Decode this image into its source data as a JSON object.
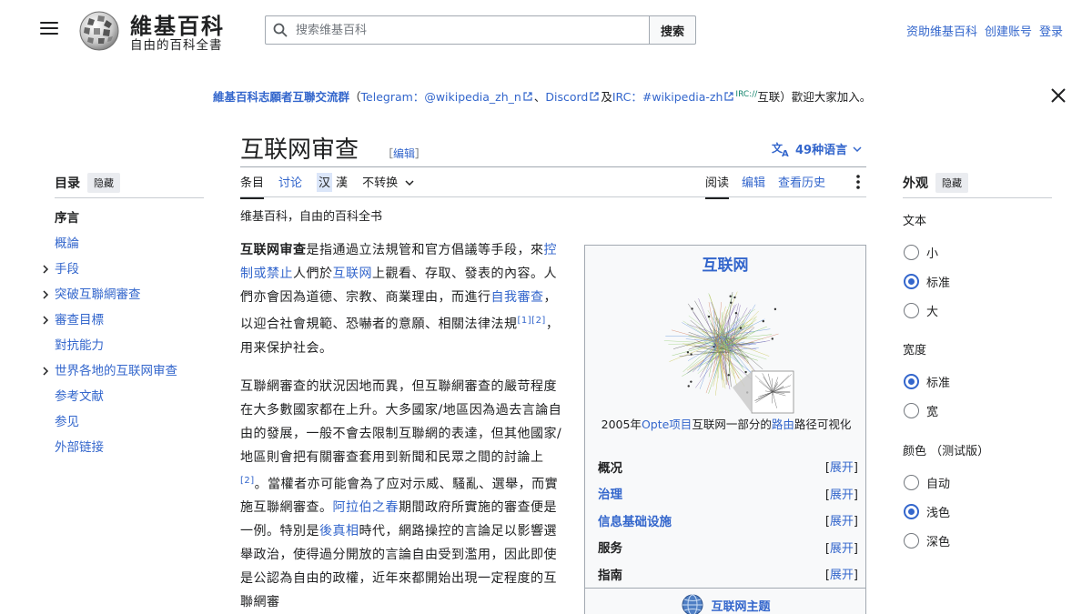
{
  "header": {
    "logo_title": "維基百科",
    "logo_tagline": "自由的百科全書",
    "search_placeholder": "搜索维基百科",
    "search_button": "搜索",
    "user_links": [
      "资助维基百科",
      "创建账号",
      "登录"
    ]
  },
  "sitenotice": {
    "group_name": "維基百科志願者互聯交流群",
    "open_paren": "（",
    "telegram_label": "Telegram：",
    "telegram_handle": "@wikipedia_zh_n",
    "sep1": "、",
    "discord": "Discord",
    "and": "及",
    "irc_label": "IRC：",
    "irc_channel": "#wikipedia-zh",
    "irc_sup": "IRC://",
    "irc_tail": "互联",
    "closing": "）歡迎大家加入。"
  },
  "page": {
    "title": "互联网审查",
    "edit_open": "［",
    "edit_label": "编辑",
    "edit_close": "］",
    "languages": "49种语言",
    "tagline": "维基百科，自由的百科全书"
  },
  "tabs": {
    "left": [
      "条目",
      "讨论"
    ],
    "variant_a": "汉",
    "variant_b": "漢",
    "converter": "不转换",
    "right": [
      "阅读",
      "编辑",
      "查看历史"
    ]
  },
  "toc": {
    "title": "目录",
    "hide": "隐藏",
    "items": [
      {
        "label": "序言",
        "current": true,
        "expandable": false
      },
      {
        "label": "概論",
        "current": false,
        "expandable": false
      },
      {
        "label": "手段",
        "current": false,
        "expandable": true
      },
      {
        "label": "突破互聯網審查",
        "current": false,
        "expandable": true
      },
      {
        "label": "審查目標",
        "current": false,
        "expandable": true
      },
      {
        "label": "對抗能力",
        "current": false,
        "expandable": false
      },
      {
        "label": "世界各地的互联网审查",
        "current": false,
        "expandable": true
      },
      {
        "label": "参考文献",
        "current": false,
        "expandable": false
      },
      {
        "label": "参见",
        "current": false,
        "expandable": false
      },
      {
        "label": "外部链接",
        "current": false,
        "expandable": false
      }
    ]
  },
  "appearance": {
    "title": "外观",
    "hide": "隐藏",
    "text_label": "文本",
    "text_options": [
      "小",
      "标准",
      "大"
    ],
    "text_selected": 1,
    "width_label": "宽度",
    "width_options": [
      "标准",
      "宽"
    ],
    "width_selected": 0,
    "color_label": "颜色 （测试版）",
    "color_options": [
      "自动",
      "浅色",
      "深色"
    ],
    "color_selected": 1
  },
  "content": {
    "p1": {
      "bold": "互联网审查",
      "t1": "是指通過立法規管和官方倡議等手段，來",
      "l1": "控制或禁止",
      "t2": "人們於",
      "l2": "互联网",
      "t3": "上觀看、存取、發表的內容。人們亦會因為道德、宗教、商業理由，而進行",
      "l3": "自我審查",
      "t4": "，以迎合社會規範、恐嚇者的意願、相關法律法規",
      "ref1": "[1]",
      "ref2": "[2]",
      "t5": "，用来保护社会。"
    },
    "p2": {
      "t1": "互聯網審查的狀況因地而異，但互聯網審查的嚴苛程度在大多數國家都在上升。大多國家/地區因為過去言論自由的發展，一般不會去限制互聯網的表達，但其他國家/地區則會把有關審查套用到新聞和民眾之間的討論上",
      "ref": "[2]",
      "t2": "。當權者亦可能會為了应对示威、騷亂、選舉，而實施互聯網審查。",
      "l1": "阿拉伯之春",
      "t3": "期間政府所實施的審查便是一例。特別是",
      "l2": "後真相",
      "t4": "時代，網路操控的言論足以影響選舉政治，使得過分開放的言論自由受到濫用，因此即使是公認為自由的政權，近年來都開始出現一定程度的互聯網審"
    }
  },
  "infobox": {
    "title": "互联网",
    "caption_t1": "2005年",
    "caption_l1": "Opte项目",
    "caption_t2": "互联网一部分的",
    "caption_l2": "路由",
    "caption_t3": "路径可视化",
    "rows": [
      {
        "label": "概况",
        "link": false
      },
      {
        "label": "治理",
        "link": true
      },
      {
        "label": "信息基础设施",
        "link": true
      },
      {
        "label": "服务",
        "link": false
      },
      {
        "label": "指南",
        "link": false
      }
    ],
    "expand_open": "[",
    "expand_label": "展开",
    "expand_close": "]",
    "portal": "互联网主题"
  }
}
